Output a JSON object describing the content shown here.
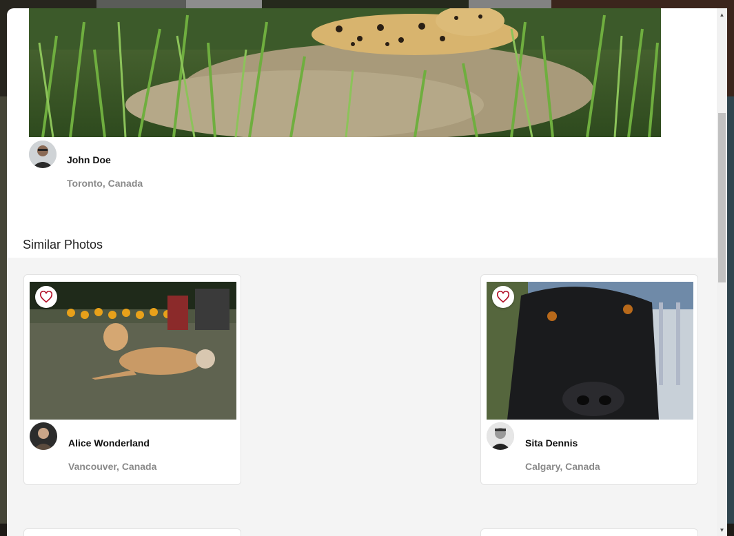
{
  "modal": {
    "author": {
      "name": "John Doe",
      "location": "Toronto, Canada"
    },
    "similar_title": "Similar Photos"
  },
  "similar_photos": [
    {
      "name": "Alice Wonderland",
      "location": "Vancouver, Canada"
    },
    {
      "name": "Sita Dennis",
      "location": "Calgary, Canada"
    }
  ],
  "icons": {
    "like": "heart-outline-icon",
    "scroll_up": "triangle-up-icon",
    "scroll_down": "triangle-down-icon"
  },
  "colors": {
    "heart": "#b3122a",
    "muted_text": "#8a8a8a",
    "section_bg": "#f4f4f4"
  }
}
